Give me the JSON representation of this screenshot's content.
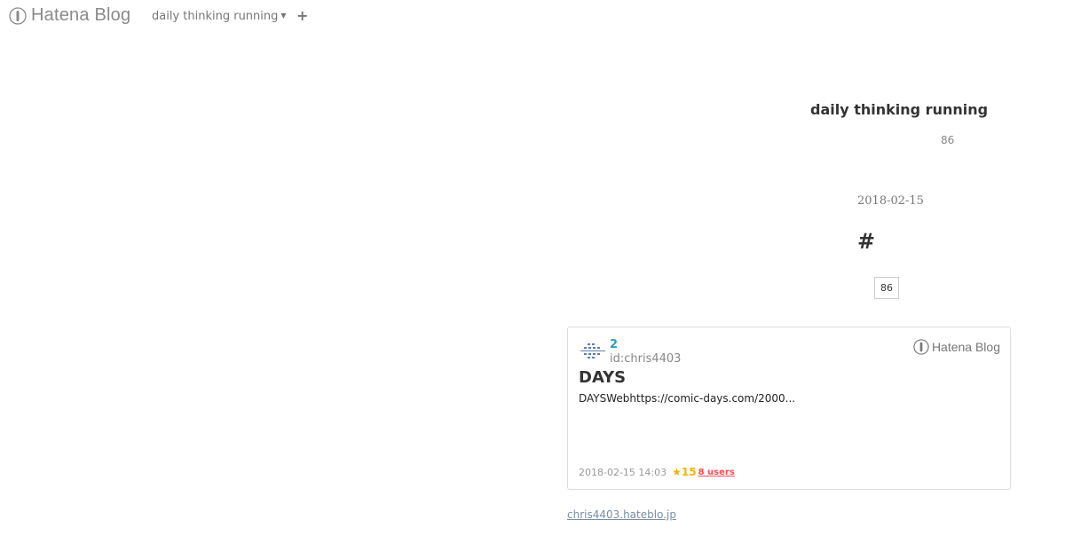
{
  "header": {
    "brand": "Hatena Blog",
    "blog_switch_label": "daily thinking running",
    "plus_label": "+"
  },
  "blog": {
    "title": "daily thinking running",
    "subscriber_count": "86"
  },
  "entry": {
    "date": "2018-02-15",
    "title": "#",
    "star_count": "86"
  },
  "card": {
    "count": "2",
    "user": "id:chris4403",
    "brand": "Hatena Blog",
    "title": "DAYS",
    "description": "DAYSWebhttps://comic-days.com/2000...",
    "timestamp": "2018-02-15 14:03",
    "stars": "★15",
    "users": "8 users"
  },
  "footer": {
    "domain": "chris4403.hateblo.jp"
  },
  "colors": {
    "link_blue": "#2a9bc9",
    "star_gold": "#f2b400",
    "users_red": "#ff4b55"
  }
}
